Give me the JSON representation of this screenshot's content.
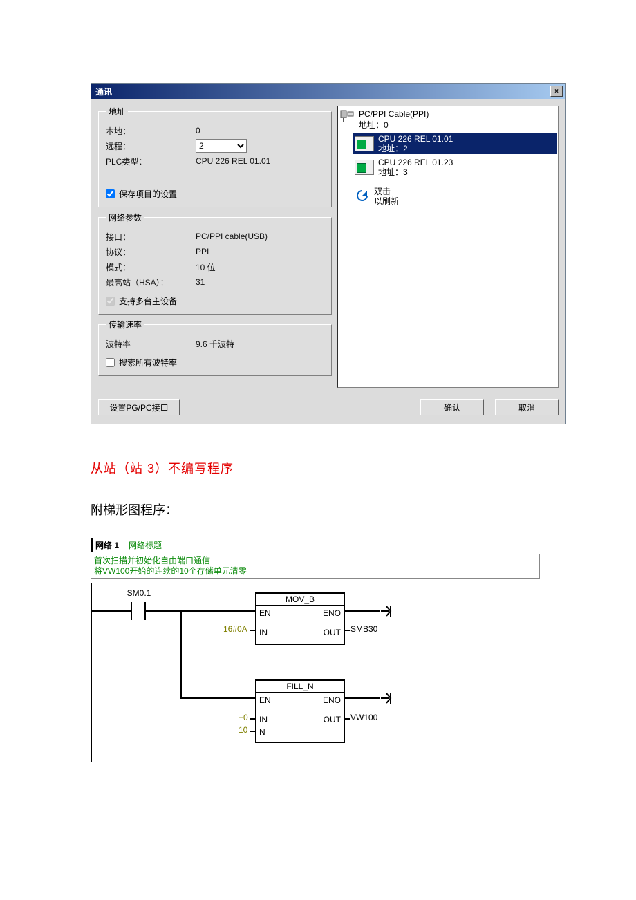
{
  "dialog": {
    "title": "通讯",
    "close": "×",
    "address_group": {
      "legend": "地址",
      "local_label": "本地：",
      "local_value": "0",
      "remote_label": "远程：",
      "remote_value": "2",
      "plctype_label": "PLC类型：",
      "plctype_value": "CPU 226 REL 01.01",
      "save_checkbox": "保存项目的设置"
    },
    "net_group": {
      "legend": "网络参数",
      "interface_label": "接口：",
      "interface_value": "PC/PPI cable(USB)",
      "protocol_label": "协议：",
      "protocol_value": "PPI",
      "mode_label": "模式：",
      "mode_value": "10 位",
      "hsa_label": "最高站（HSA）：",
      "hsa_value": "31",
      "multimaster_checkbox": "支持多台主设备"
    },
    "baud_group": {
      "legend": "传输速率",
      "baud_label": "波特率",
      "baud_value": "9.6 千波特",
      "search_checkbox": "搜索所有波特率"
    },
    "tree": {
      "root_name": "PC/PPI Cable(PPI)",
      "root_addr": "地址：0",
      "items": [
        {
          "name": "CPU 226 REL 01.01",
          "addr": "地址：2",
          "selected": true
        },
        {
          "name": "CPU 226 REL 01.23",
          "addr": "地址：3",
          "selected": false
        }
      ],
      "refresh_line1": "双击",
      "refresh_line2": "以刷新"
    },
    "buttons": {
      "pgpc": "设置PG/PC接口",
      "ok": "确认",
      "cancel": "取消"
    }
  },
  "text": {
    "red": "从站（站 3）不编写程序",
    "black": "附梯形图程序："
  },
  "ladder": {
    "net_label": "网络 1",
    "net_title": "网络标题",
    "desc_line1": "首次扫描并初始化自由端口通信",
    "desc_line2": "将VW100开始的连续的10个存储单元清零",
    "contact": "SM0.1",
    "block1": {
      "title": "MOV_B",
      "en": "EN",
      "eno": "ENO",
      "in": "IN",
      "out": "OUT",
      "in_val": "16#0A",
      "out_val": "SMB30"
    },
    "block2": {
      "title": "FILL_N",
      "en": "EN",
      "eno": "ENO",
      "in": "IN",
      "out": "OUT",
      "n": "N",
      "in_val": "+0",
      "n_val": "10",
      "out_val": "VW100"
    }
  }
}
